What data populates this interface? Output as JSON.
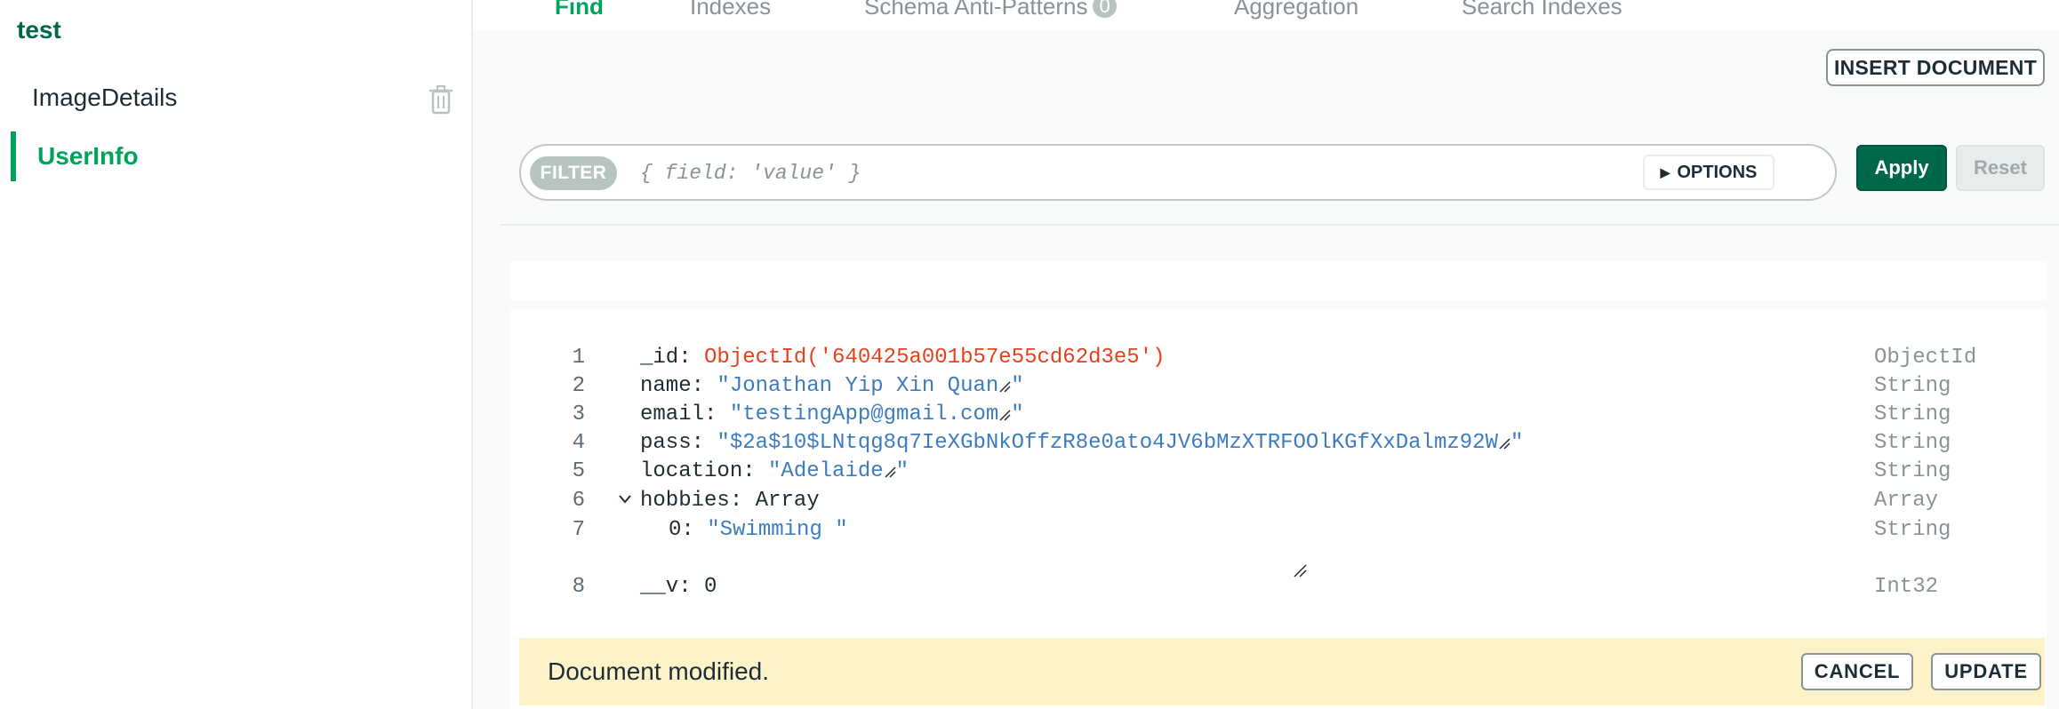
{
  "sidebar": {
    "database": "test",
    "collections": [
      {
        "label": "ImageDetails"
      },
      {
        "label": "UserInfo"
      }
    ]
  },
  "tabs": [
    {
      "label": "Find"
    },
    {
      "label": "Indexes"
    },
    {
      "label": "Schema Anti-Patterns",
      "badge": "0"
    },
    {
      "label": "Aggregation"
    },
    {
      "label": "Search Indexes"
    }
  ],
  "toolbar": {
    "insert_label": "INSERT DOCUMENT",
    "filter_label": "FILTER",
    "filter_placeholder": "{ field: 'value' }",
    "options_label": "OPTIONS",
    "apply_label": "Apply",
    "reset_label": "Reset"
  },
  "document": {
    "lines": [
      {
        "num": "1",
        "key": "_id",
        "value": "ObjectId('640425a001b57e55cd62d3e5')",
        "type": "ObjectId"
      },
      {
        "num": "2",
        "key": "name",
        "value": "\"Jonathan Yip Xin Quan",
        "close": "\"",
        "type": "String"
      },
      {
        "num": "3",
        "key": "email",
        "value": "\"testingApp@gmail.com",
        "close": "\"",
        "type": "String"
      },
      {
        "num": "4",
        "key": "pass",
        "value": "\"$2a$10$LNtqg8q7IeXGbNkOffzR8e0ato4JV6bMzXTRFOOlKGfXxDalmz92W",
        "close": "\"",
        "type": "String"
      },
      {
        "num": "5",
        "key": "location",
        "value": "\"Adelaide",
        "close": "\"",
        "type": "String"
      },
      {
        "num": "6",
        "key": "hobbies",
        "value": "Array",
        "type": "Array"
      },
      {
        "num": "7",
        "key": "0",
        "value": "\"Swimming \"",
        "type": "String"
      },
      {
        "num": "8",
        "key": "__v",
        "value": "0",
        "type": "Int32"
      }
    ]
  },
  "status": {
    "message": "Document modified.",
    "cancel_label": "CANCEL",
    "update_label": "UPDATE"
  },
  "colors": {
    "accent": "#00a35c",
    "accent_dark": "#00684a",
    "objectid": "#e5421b",
    "string": "#3d7cbf",
    "modified_bg": "#fef2c8"
  }
}
